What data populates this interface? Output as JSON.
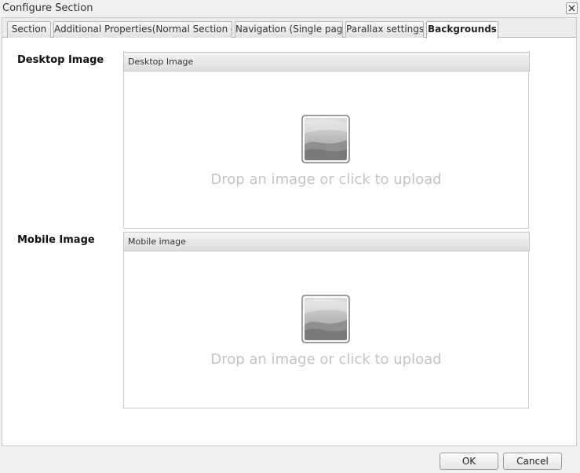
{
  "window": {
    "title": "Configure Section",
    "close_icon": "close-icon"
  },
  "tabs": [
    {
      "label": "Section",
      "active": false
    },
    {
      "label": "Additional Properties(Normal Section only)",
      "active": false
    },
    {
      "label": "Navigation (Single page)",
      "active": false
    },
    {
      "label": "Parallax settings",
      "active": false
    },
    {
      "label": "Backgrounds",
      "active": true
    }
  ],
  "backgrounds": {
    "desktop": {
      "row_label": "Desktop Image",
      "panel_title": "Desktop Image",
      "drop_text": "Drop an image or click to upload",
      "icon": "image-placeholder-icon"
    },
    "mobile": {
      "row_label": "Mobile Image",
      "panel_title": "Mobile image",
      "drop_text": "Drop an image or click to upload",
      "icon": "image-placeholder-icon"
    }
  },
  "footer": {
    "ok_label": "OK",
    "cancel_label": "Cancel"
  },
  "colors": {
    "background": "#f0f0f0",
    "drop_text": "#c4c4c4"
  }
}
